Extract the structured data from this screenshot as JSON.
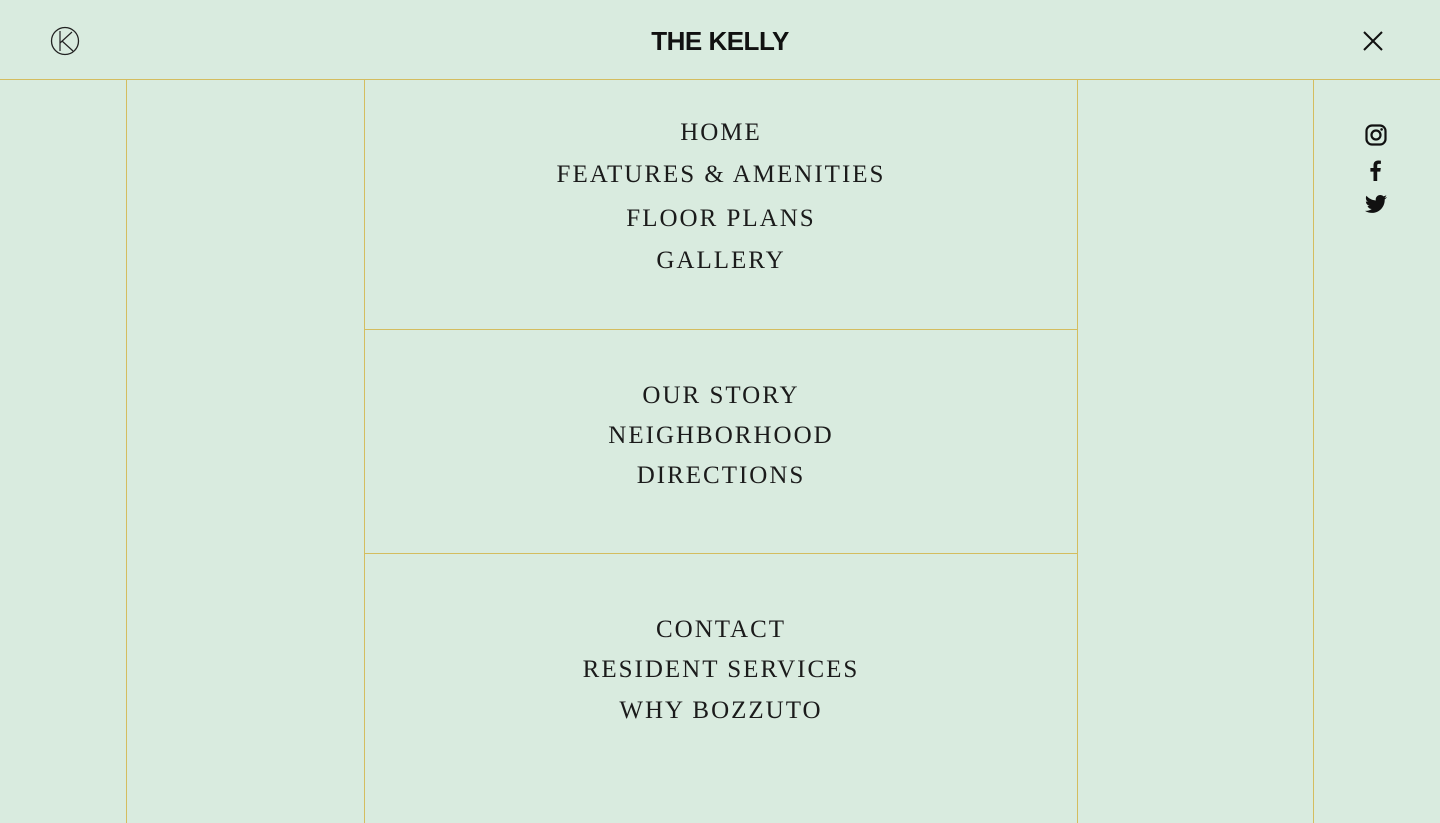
{
  "header": {
    "title": "THE KELLY",
    "logo_icon": "circle-k-monogram-icon",
    "close_icon": "close-icon"
  },
  "menu": {
    "group1": [
      {
        "label": "HOME"
      },
      {
        "label": "FEATURES & AMENITIES"
      },
      {
        "label": "FLOOR PLANS"
      },
      {
        "label": "GALLERY"
      }
    ],
    "group2": [
      {
        "label": "OUR STORY"
      },
      {
        "label": "NEIGHBORHOOD"
      },
      {
        "label": "DIRECTIONS"
      }
    ],
    "group3": [
      {
        "label": "CONTACT"
      },
      {
        "label": "RESIDENT SERVICES"
      },
      {
        "label": "WHY BOZZUTO"
      }
    ]
  },
  "social": [
    {
      "icon": "instagram-icon"
    },
    {
      "icon": "facebook-icon"
    },
    {
      "icon": "twitter-icon"
    }
  ],
  "colors": {
    "background": "#d9ebdf",
    "rule": "#d4bd5f",
    "text": "#1b1b1b"
  }
}
